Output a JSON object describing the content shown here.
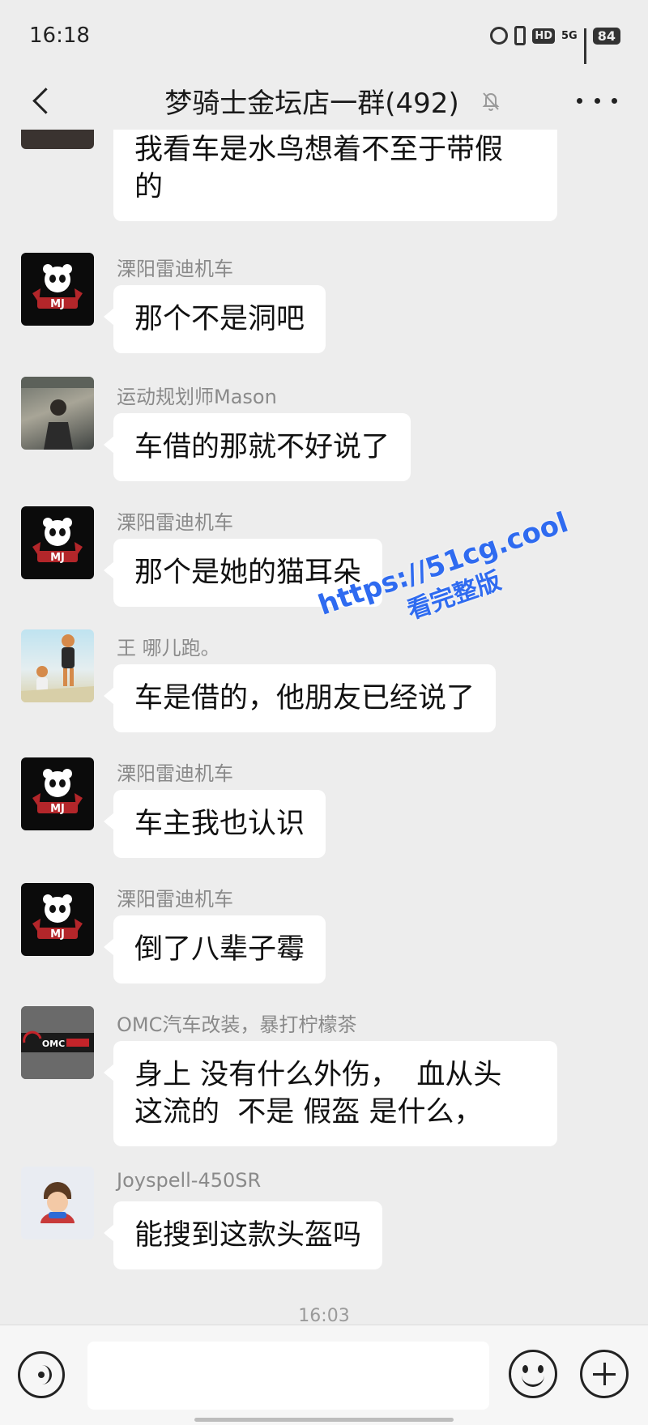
{
  "status_bar": {
    "time": "16:18",
    "network": "5G",
    "hd": "HD",
    "battery": "84"
  },
  "header": {
    "title": "梦骑士金坛店一群(492)"
  },
  "messages": [
    {
      "sender": "",
      "text_lines": [
        "我看车是水鸟想着不至于带假",
        "的"
      ]
    },
    {
      "sender": "溧阳雷迪机车",
      "text": "那个不是洞吧"
    },
    {
      "sender": "运动规划师Mason",
      "text": "车借的那就不好说了"
    },
    {
      "sender": "溧阳雷迪机车",
      "text": "那个是她的猫耳朵"
    },
    {
      "sender": "王 哪儿跑。",
      "text": "车是借的，他朋友已经说了"
    },
    {
      "sender": "溧阳雷迪机车",
      "text": "车主我也认识"
    },
    {
      "sender": "溧阳雷迪机车",
      "text": "倒了八辈子霉"
    },
    {
      "sender": "OMC汽车改装，暴打柠檬茶",
      "text_lines": [
        "身上 没有什么外伤，  血从头",
        "这流的  不是 假盔 是什么，"
      ]
    },
    {
      "sender": "Joyspell-450SR",
      "text": "能搜到这款头盔吗"
    }
  ],
  "avatar_labels": {
    "mj": "MJ",
    "omc": "OMC"
  },
  "timestamp": "16:03",
  "watermark": {
    "url": "https://51cg.cool",
    "subtitle": "看完整版"
  },
  "input": {
    "value": ""
  }
}
